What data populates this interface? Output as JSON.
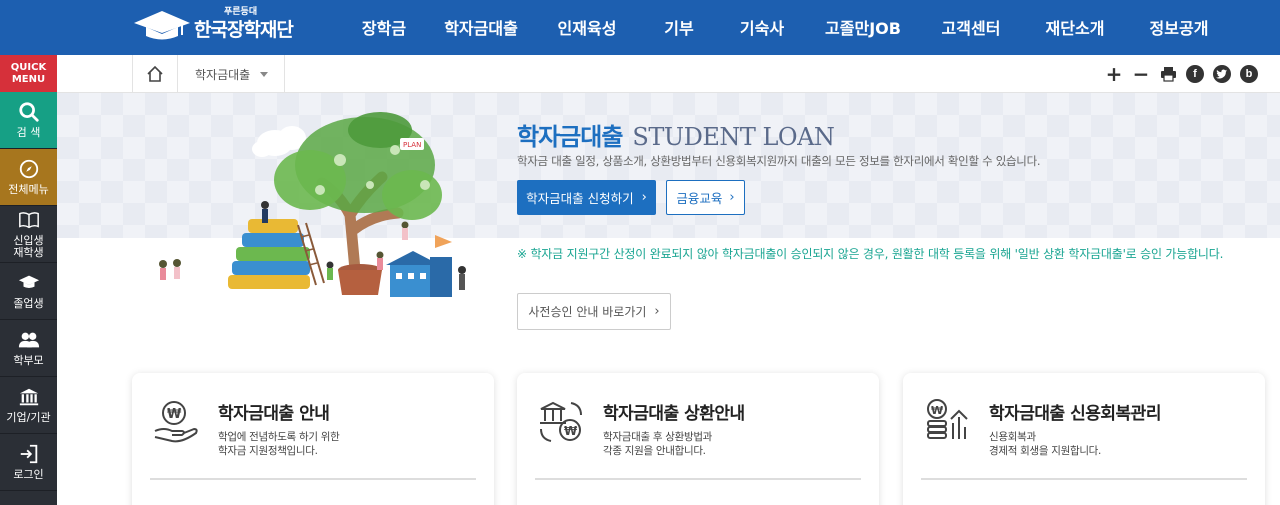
{
  "header": {
    "logo_small": "푸른등대",
    "logo_main": "한국장학재단",
    "nav": [
      "장학금",
      "학자금대출",
      "인재육성",
      "기부",
      "기숙사",
      "고졸만JOB",
      "고객센터",
      "재단소개",
      "정보공개"
    ]
  },
  "quick_menu": {
    "title_line1": "QUICK",
    "title_line2": "MENU",
    "items": [
      {
        "label": "검 색",
        "icon": "search-icon"
      },
      {
        "label": "전체메뉴",
        "icon": "compass-icon"
      },
      {
        "label_line1": "신입생",
        "label_line2": "재학생",
        "icon": "book-icon"
      },
      {
        "label": "졸업생",
        "icon": "graduation-cap-icon"
      },
      {
        "label": "학부모",
        "icon": "parents-icon"
      },
      {
        "label": "기업/기관",
        "icon": "institution-icon"
      },
      {
        "label": "로그인",
        "icon": "login-icon"
      }
    ]
  },
  "breadcrumb": {
    "current": "학자금대출"
  },
  "tools": {
    "zoom_in": "+",
    "zoom_out": "−",
    "facebook": "f",
    "blog": "b"
  },
  "hero": {
    "title_ko": "학자금대출",
    "title_en": "STUDENT LOAN",
    "description": "학자금 대출 일정, 상품소개, 상환방법부터 신용회복지원까지 대출의 모든 정보를 한자리에서 확인할 수 있습니다.",
    "apply_button": "학자금대출 신청하기",
    "edu_button": "금융교육",
    "notice": "※ 학자금 지원구간 산정이 완료되지 않아 학자금대출이 승인되지 않은 경우, 원활한 대학 등록을 위해 '일반 상환 학자금대출'로 승인 가능합니다.",
    "pre_approval_button": "사전승인 안내 바로가기",
    "illustration_sign": "PLAN"
  },
  "cards": [
    {
      "title": "학자금대출 안내",
      "desc_line1": "학업에 전념하도록 하기 위한",
      "desc_line2": "학자금 지원정책입니다.",
      "icon": "coin-hand-icon"
    },
    {
      "title": "학자금대출 상환안내",
      "desc_line1": "학자금대출 후 상환방법과",
      "desc_line2": "각종 지원을 안내합니다.",
      "icon": "bank-repay-icon"
    },
    {
      "title": "학자금대출 신용회복관리",
      "desc_line1": "신용회복과",
      "desc_line2": "경제적 회생을 지원합니다.",
      "icon": "coin-growth-icon"
    }
  ],
  "colors": {
    "header_bg": "#1d5fb0",
    "accent_blue": "#1d6fc0",
    "notice_green": "#1aa592",
    "quick_red": "#d6303a",
    "quick_teal": "#16a085",
    "quick_gold": "#a7761e"
  }
}
